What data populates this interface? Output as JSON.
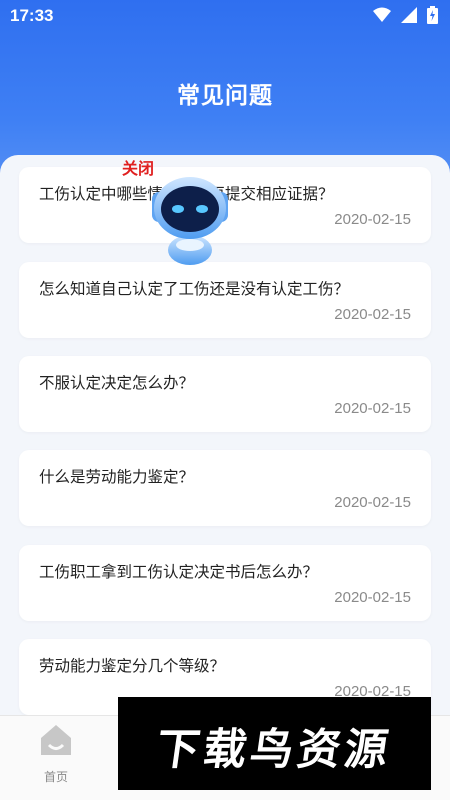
{
  "status_bar": {
    "time": "17:33"
  },
  "header": {
    "title": "常见问题"
  },
  "faq_items": [
    {
      "question": "工伤认定中哪些情况需要再提交相应证据？",
      "date": "2020-02-15"
    },
    {
      "question": "怎么知道自己认定了工伤还是没有认定工伤？",
      "date": "2020-02-15"
    },
    {
      "question": "不服认定决定怎么办？",
      "date": "2020-02-15"
    },
    {
      "question": "什么是劳动能力鉴定？",
      "date": "2020-02-15"
    },
    {
      "question": "工伤职工拿到工伤认定决定书后怎么办？",
      "date": "2020-02-15"
    },
    {
      "question": "劳动能力鉴定分几个等级？",
      "date": "2020-02-15"
    }
  ],
  "robot": {
    "close_label": "关闭"
  },
  "tab_bar": {
    "home_label": "首页",
    "home_icon": "home-icon"
  },
  "watermark": {
    "text": "下载鸟资源"
  },
  "colors": {
    "header_blue": "#2f6ff0",
    "close_red": "#e02020",
    "date_gray": "#8a8a8a"
  }
}
